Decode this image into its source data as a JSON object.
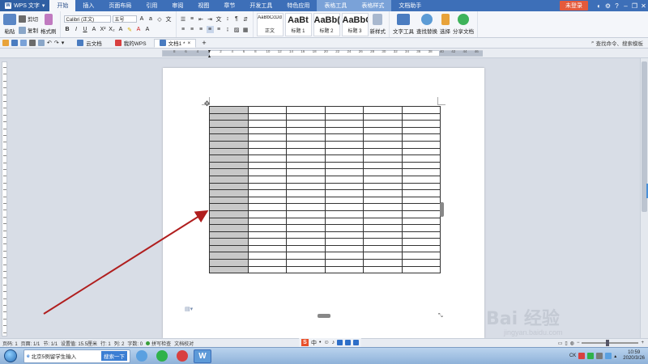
{
  "app": {
    "name": "WPS 文字",
    "login_label": "未登录"
  },
  "menu": {
    "tabs": [
      {
        "label": "开始",
        "active": true
      },
      {
        "label": "插入"
      },
      {
        "label": "页面布局"
      },
      {
        "label": "引用"
      },
      {
        "label": "审阅"
      },
      {
        "label": "视图"
      },
      {
        "label": "章节"
      },
      {
        "label": "开发工具"
      },
      {
        "label": "特色应用"
      },
      {
        "label": "表格工具",
        "table": true
      },
      {
        "label": "表格样式",
        "table": true
      },
      {
        "label": "文档助手"
      }
    ]
  },
  "ribbon": {
    "paste_label": "粘贴",
    "cut_label": "剪切",
    "copy_label": "复制",
    "format_painter_label": "格式刷",
    "font_name": "Calibri (正文)",
    "font_size": "五号",
    "styles": [
      {
        "sample": "AaBbCcDd",
        "name": "正文",
        "big": false
      },
      {
        "sample": "AaBt",
        "name": "标题 1",
        "big": true
      },
      {
        "sample": "AaBb(",
        "name": "标题 2",
        "big": true
      },
      {
        "sample": "AaBbC",
        "name": "标题 3",
        "big": true
      }
    ],
    "new_style_label": "新样式",
    "text_tools_label": "文字工具",
    "find_replace_label": "查找替换",
    "select_label": "选择",
    "share_label": "分享文档"
  },
  "doc_tabs": [
    {
      "label": "云文档",
      "active": false
    },
    {
      "label": "我的WPS",
      "active": false
    },
    {
      "label": "文档1 *",
      "active": true
    }
  ],
  "search": {
    "placeholder": "查找命令、搜索模板"
  },
  "ruler": {
    "labels": [
      "8",
      "6",
      "4",
      "2",
      "2",
      "4",
      "6",
      "8",
      "10",
      "12",
      "14",
      "16",
      "18",
      "20",
      "22",
      "24",
      "26",
      "28",
      "30",
      "32",
      "34",
      "36",
      "38",
      "40",
      "42",
      "44",
      "46"
    ]
  },
  "table": {
    "rows": 24,
    "cols": 6,
    "shaded_col": 0
  },
  "status": {
    "page": "页码: 1",
    "pages": "页面: 1/1",
    "section": "节: 1/1",
    "setting": "设置值: 15.5厘米",
    "row": "行: 1",
    "col": "列: 2",
    "words": "字数: 0",
    "spell_check": "拼写检查",
    "doc_check": "文档校对"
  },
  "zoom": {
    "minus_label": "−",
    "plus_label": "+"
  },
  "taskbar": {
    "ime_text": "北京5例留学生输入",
    "search_btn": "搜索一下",
    "clock_time": "10:59",
    "clock_date": "2020/3/26",
    "ck_label": "CK"
  },
  "watermark": {
    "main": "Bai  经验",
    "sub": "jingyan.baidu.com"
  },
  "colors": {
    "title_bg": "#3d6fb8",
    "login_bg": "#e45a3c",
    "arrow": "#b01e1e",
    "shaded_cell": "#c8c8c8"
  }
}
